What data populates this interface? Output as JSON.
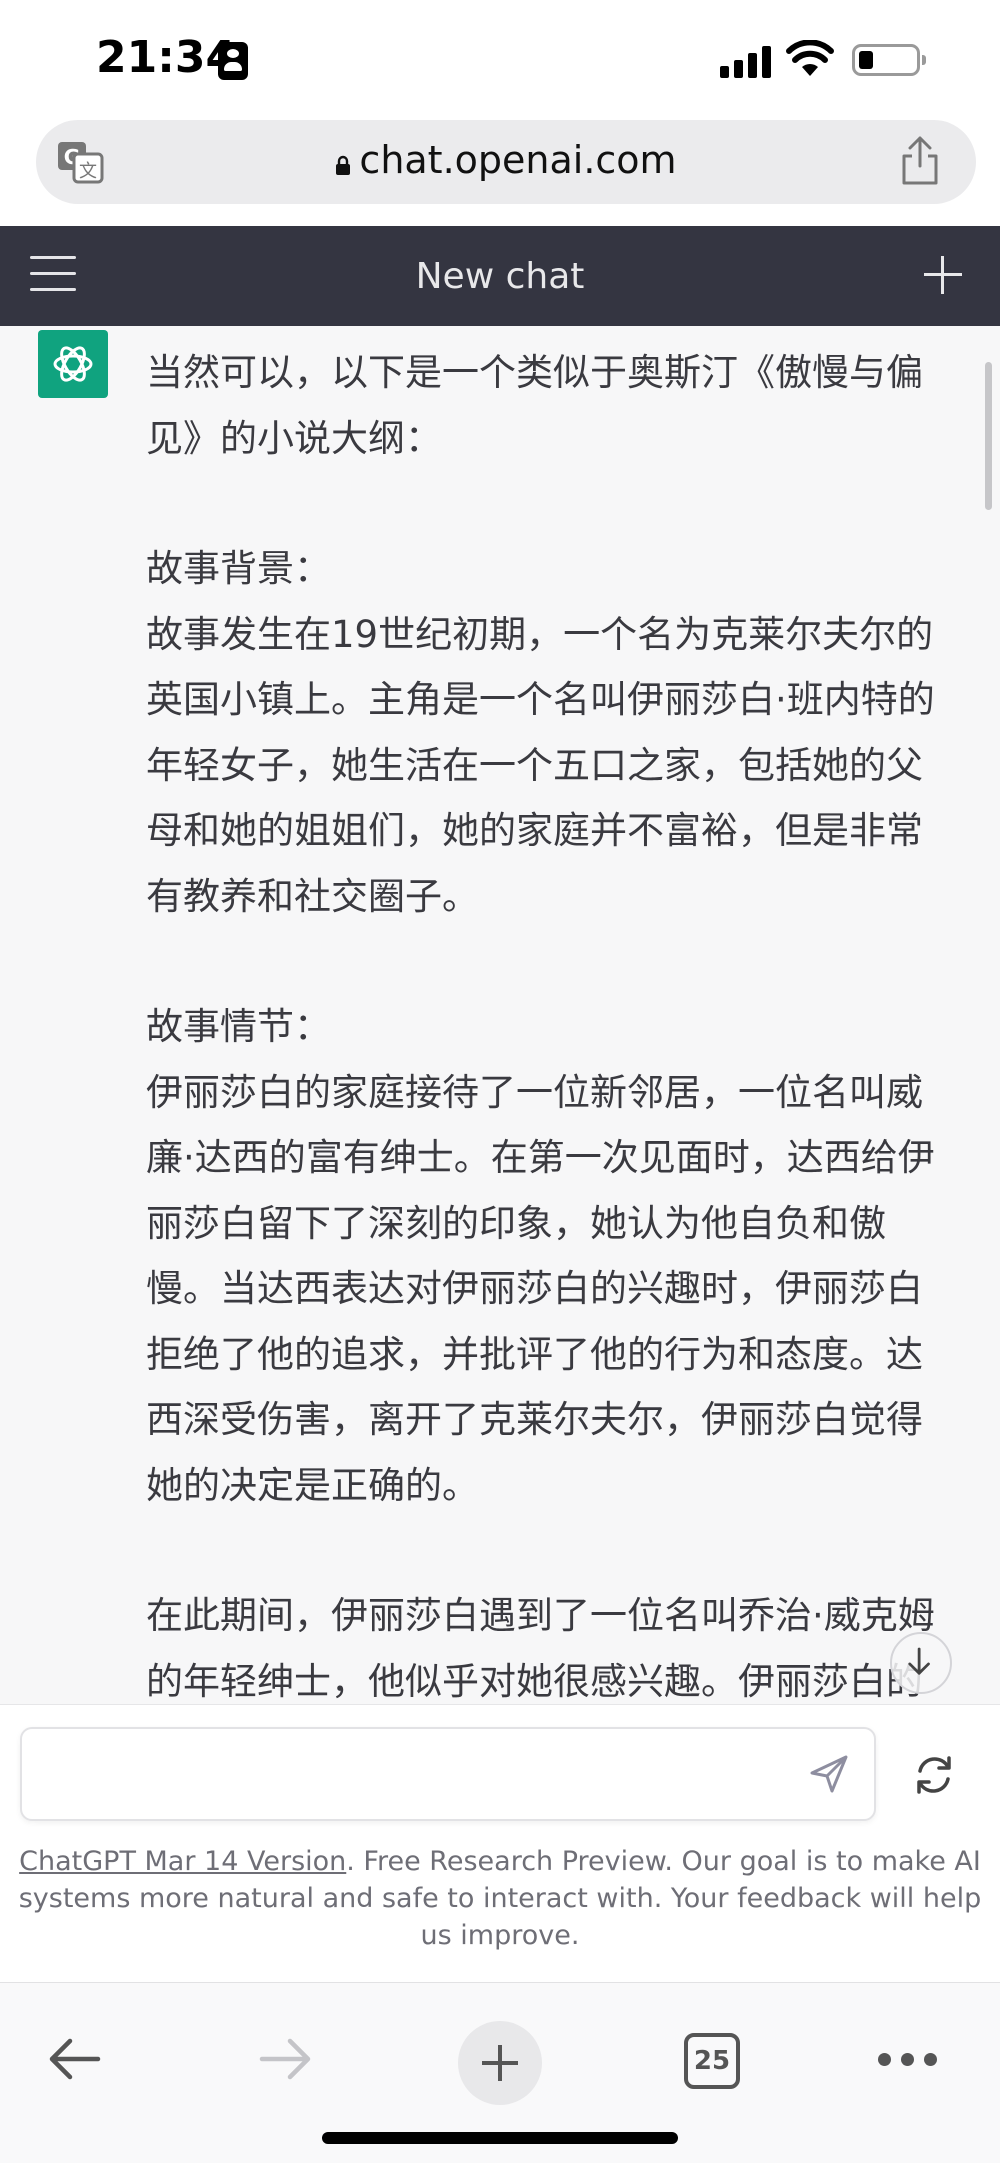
{
  "status_bar": {
    "time": "21:34"
  },
  "browser": {
    "url": "chat.openai.com",
    "tab_count": "25"
  },
  "header": {
    "title": "New chat"
  },
  "message": {
    "paragraphs": [
      "当然可以，以下是一个类似于奥斯汀《傲慢与偏见》的小说大纲：",
      "故事背景：",
      "故事发生在19世纪初期，一个名为克莱尔夫尔的英国小镇上。主角是一个名叫伊丽莎白·班内特的年轻女子，她生活在一个五口之家，包括她的父母和她的姐姐们，她的家庭并不富裕，但是非常有教养和社交圈子。",
      "故事情节：",
      "伊丽莎白的家庭接待了一位新邻居，一位名叫威廉·达西的富有绅士。在第一次见面时，达西给伊丽莎白留下了深刻的印象，她认为他自负和傲慢。当达西表达对伊丽莎白的兴趣时，伊丽莎白拒绝了他的追求，并批评了他的行为和态度。达西深受伤害，离开了克莱尔夫尔，伊丽莎白觉得她的决定是正确的。",
      "在此期间，伊丽莎白遇到了一位名叫乔治·威克姆的年轻绅士，他似乎对她很感兴趣。伊丽莎白的好友简也遇到了一位富有年轻人，名叫查尔斯"
    ]
  },
  "composer": {
    "placeholder": ""
  },
  "footer": {
    "version_link": "ChatGPT Mar 14 Version",
    "disclaimer": ". Free Research Preview. Our goal is to make AI systems more natural and safe to interact with. Your feedback will help us improve."
  },
  "icons": {
    "translate": "translate-icon",
    "lock": "lock-icon",
    "share": "share-icon",
    "menu": "hamburger-menu-icon",
    "new_chat": "plus-icon",
    "assistant": "openai-logo-icon",
    "send": "send-icon",
    "regenerate": "refresh-icon",
    "scroll_down": "arrow-down-icon",
    "back": "arrow-left-icon",
    "forward": "arrow-right-icon",
    "more": "more-dots-icon"
  },
  "colors": {
    "header_bg": "#343541",
    "chat_bg": "#f7f7f8",
    "brand_green": "#10a37f"
  }
}
